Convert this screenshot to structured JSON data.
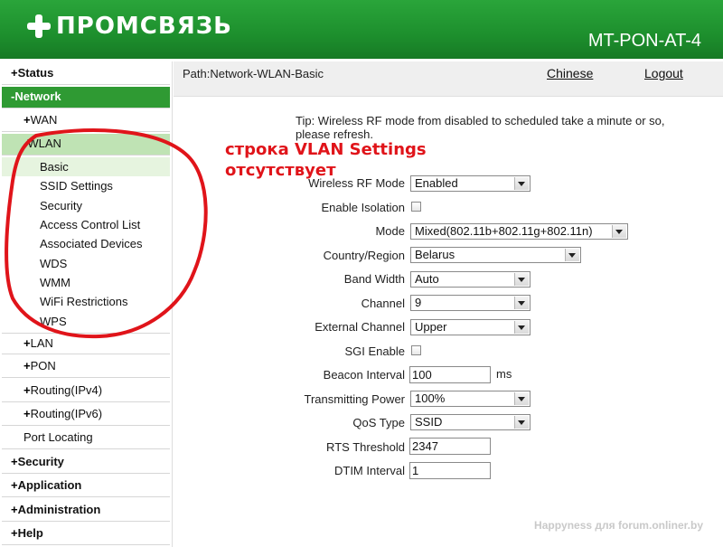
{
  "header": {
    "logo_text": "ПРОМСВЯЗЬ",
    "model": "MT-PON-AT-4",
    "brand_color": "#1d8f2d"
  },
  "sidebar": {
    "items": [
      {
        "label": "Status",
        "prefix": "+"
      },
      {
        "label": "Network",
        "prefix": "-"
      },
      {
        "label": "WAN",
        "prefix": "+"
      },
      {
        "label": "WLAN",
        "prefix": "-"
      },
      {
        "label": "Basic"
      },
      {
        "label": "SSID Settings"
      },
      {
        "label": "Security"
      },
      {
        "label": "Access Control List"
      },
      {
        "label": "Associated Devices"
      },
      {
        "label": "WDS"
      },
      {
        "label": "WMM"
      },
      {
        "label": "WiFi Restrictions"
      },
      {
        "label": "WPS"
      },
      {
        "label": "LAN",
        "prefix": "+"
      },
      {
        "label": "PON",
        "prefix": "+"
      },
      {
        "label": "Routing(IPv4)",
        "prefix": "+"
      },
      {
        "label": "Routing(IPv6)",
        "prefix": "+"
      },
      {
        "label": "Port Locating"
      },
      {
        "label": "Security",
        "prefix": "+"
      },
      {
        "label": "Application",
        "prefix": "+"
      },
      {
        "label": "Administration",
        "prefix": "+"
      },
      {
        "label": "Help",
        "prefix": "+"
      }
    ]
  },
  "pathbar": {
    "path": "Path:Network-WLAN-Basic",
    "chinese": "Chinese",
    "logout": "Logout"
  },
  "tip": "Tip: Wireless RF mode from disabled to scheduled take a minute or so, please refresh.",
  "annotation": {
    "line1": "строка VLAN Settings",
    "line2": "отсутствует"
  },
  "form": {
    "wireless_rf_mode": {
      "label": "Wireless RF Mode",
      "value": "Enabled"
    },
    "enable_isolation": {
      "label": "Enable Isolation",
      "checked": false
    },
    "mode": {
      "label": "Mode",
      "value": "Mixed(802.11b+802.11g+802.11n)"
    },
    "country": {
      "label": "Country/Region",
      "value": "Belarus"
    },
    "band_width": {
      "label": "Band Width",
      "value": "Auto"
    },
    "channel": {
      "label": "Channel",
      "value": "9"
    },
    "external_channel": {
      "label": "External Channel",
      "value": "Upper"
    },
    "sgi_enable": {
      "label": "SGI Enable",
      "checked": false
    },
    "beacon_interval": {
      "label": "Beacon Interval",
      "value": "100",
      "unit": "ms"
    },
    "transmitting_power": {
      "label": "Transmitting Power",
      "value": "100%"
    },
    "qos_type": {
      "label": "QoS Type",
      "value": "SSID"
    },
    "rts_threshold": {
      "label": "RTS Threshold",
      "value": "2347"
    },
    "dtim_interval": {
      "label": "DTIM Interval",
      "value": "1"
    }
  },
  "watermark": "Happyness для forum.onliner.by"
}
